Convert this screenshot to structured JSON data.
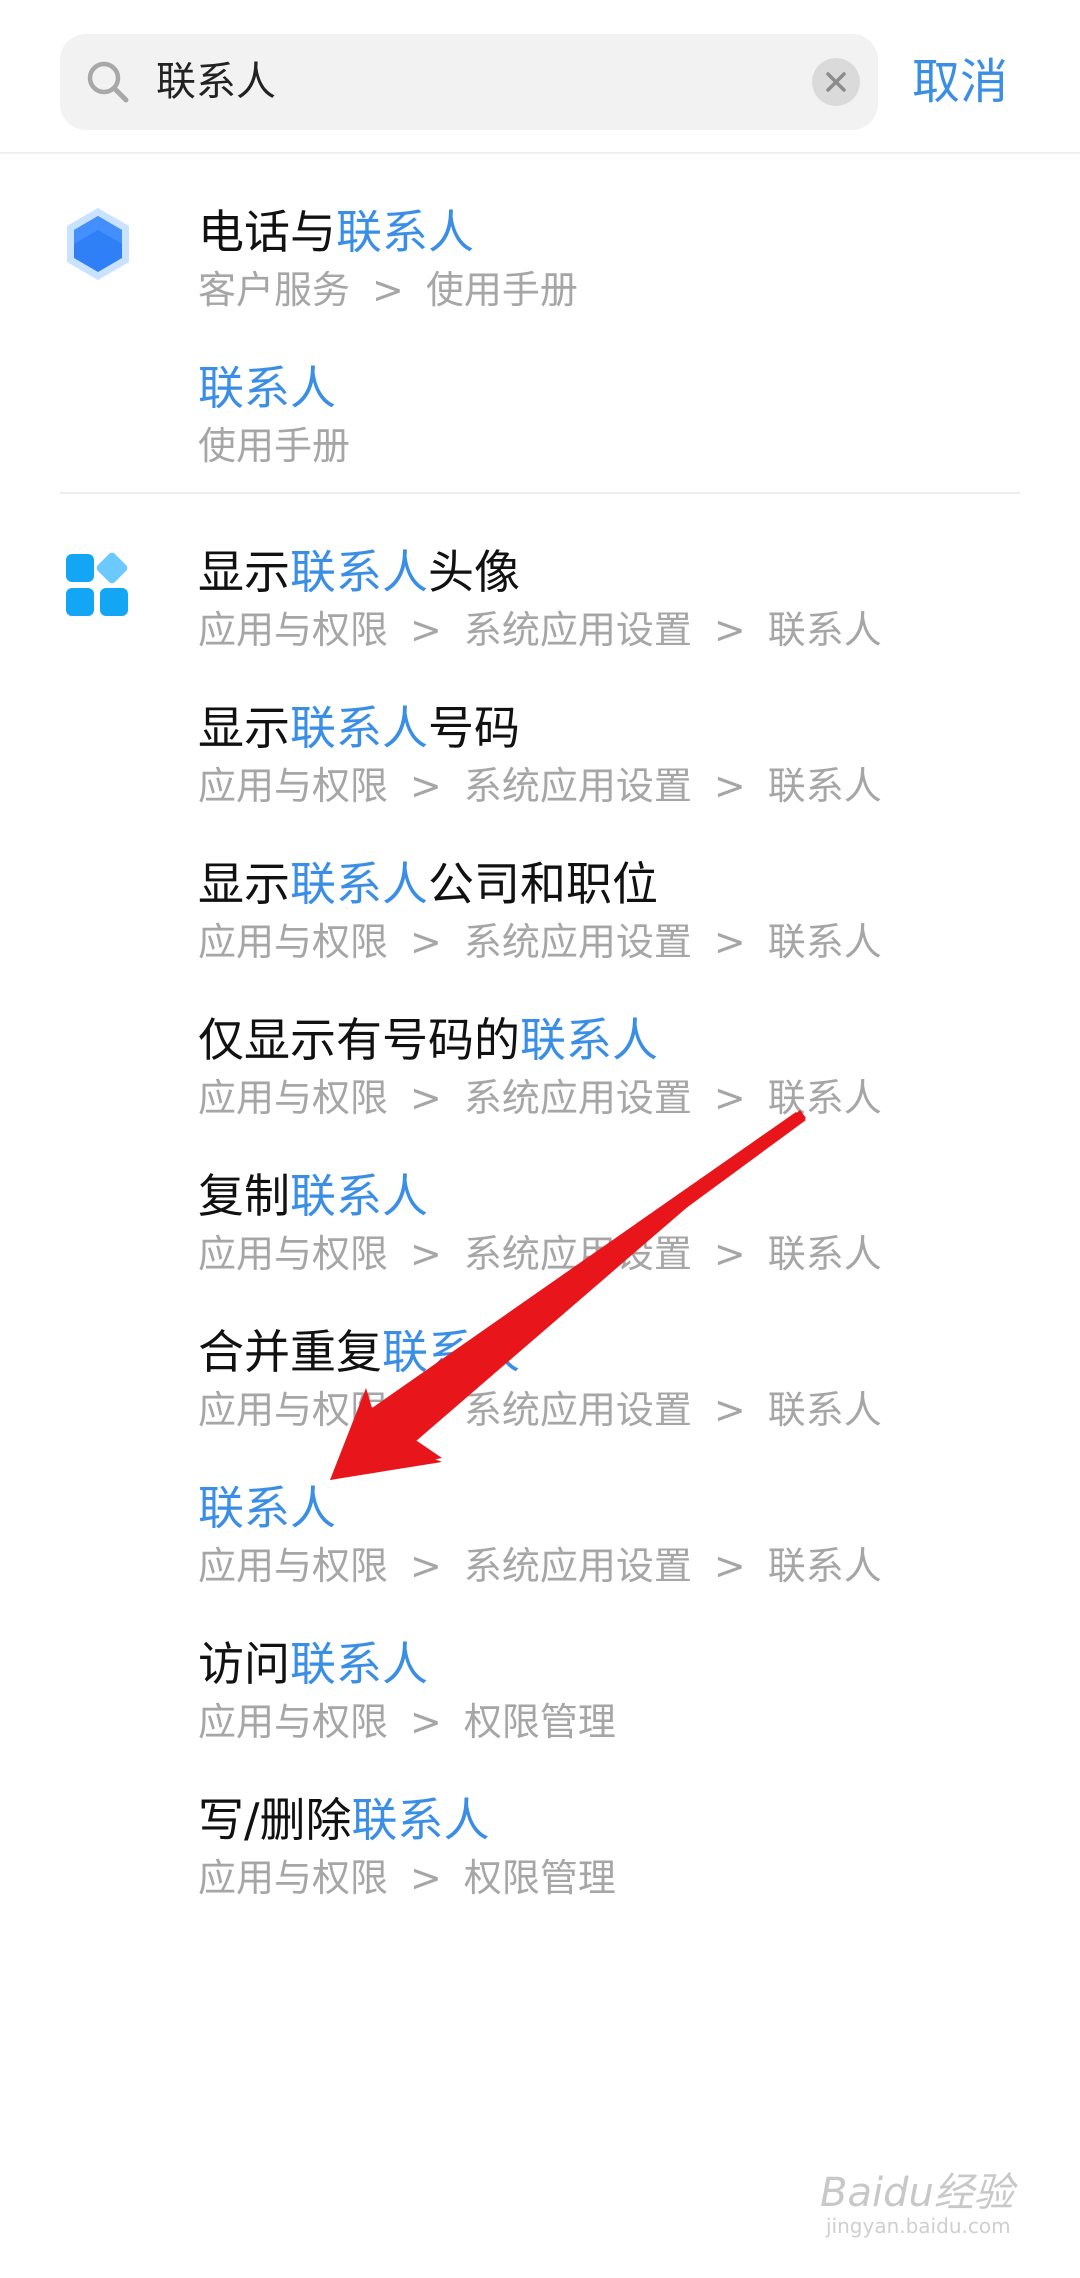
{
  "search": {
    "query": "联系人",
    "cancel_label": "取消"
  },
  "results": [
    {
      "pre": "电话与",
      "hl": "联系人",
      "post": "",
      "path": [
        "客户服务",
        "使用手册"
      ]
    },
    {
      "pre": "",
      "hl": "联系人",
      "post": "",
      "path": [
        "使用手册"
      ]
    },
    {
      "pre": "显示",
      "hl": "联系人",
      "post": "头像",
      "path": [
        "应用与权限",
        "系统应用设置",
        "联系人"
      ]
    },
    {
      "pre": "显示",
      "hl": "联系人",
      "post": "号码",
      "path": [
        "应用与权限",
        "系统应用设置",
        "联系人"
      ]
    },
    {
      "pre": "显示",
      "hl": "联系人",
      "post": "公司和职位",
      "path": [
        "应用与权限",
        "系统应用设置",
        "联系人"
      ]
    },
    {
      "pre": "仅显示有号码的",
      "hl": "联系人",
      "post": "",
      "path": [
        "应用与权限",
        "系统应用设置",
        "联系人"
      ]
    },
    {
      "pre": "复制",
      "hl": "联系人",
      "post": "",
      "path": [
        "应用与权限",
        "系统应用设置",
        "联系人"
      ]
    },
    {
      "pre": "合并重复",
      "hl": "联系人",
      "post": "",
      "path": [
        "应用与权限",
        "系统应用设置",
        "联系人"
      ]
    },
    {
      "pre": "",
      "hl": "联系人",
      "post": "",
      "path": [
        "应用与权限",
        "系统应用设置",
        "联系人"
      ]
    },
    {
      "pre": "访问",
      "hl": "联系人",
      "post": "",
      "path": [
        "应用与权限",
        "权限管理"
      ]
    },
    {
      "pre": "写/删除",
      "hl": "联系人",
      "post": "",
      "path": [
        "应用与权限",
        "权限管理"
      ]
    }
  ],
  "path_separator": ">",
  "icons": {
    "group1": "hexagon-icon",
    "group2": "apps-grid-icon"
  },
  "colors": {
    "highlight": "#3a8ee6",
    "arrow": "#e8161b"
  },
  "watermark": {
    "brand": "Baidu经验",
    "url": "jingyan.baidu.com"
  }
}
